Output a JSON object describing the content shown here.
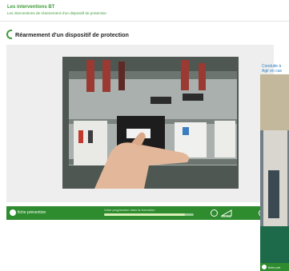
{
  "header": {
    "title": "Les interventions BT",
    "subtitle": "Les interventions de réarmement d'un dispositif de protection"
  },
  "section": {
    "title": "Réarmement d'un dispositif de protection"
  },
  "player": {
    "fiche_label": "fiche prévention",
    "progress_label": "Votre progression dans la formation :",
    "progress": 0.9,
    "volume_label": "VOLUME",
    "icons": [
      "info-icon",
      "restart-icon",
      "volume-icon",
      "next-icon"
    ]
  },
  "side_panel": {
    "title_line1": "Conduite à",
    "title_line2": "Agir en cas",
    "bar_label": "fiche pré"
  },
  "colors": {
    "brand_green": "#3f9b3a",
    "bar_green": "#2e8b2e",
    "link_blue": "#2d7fc2"
  }
}
